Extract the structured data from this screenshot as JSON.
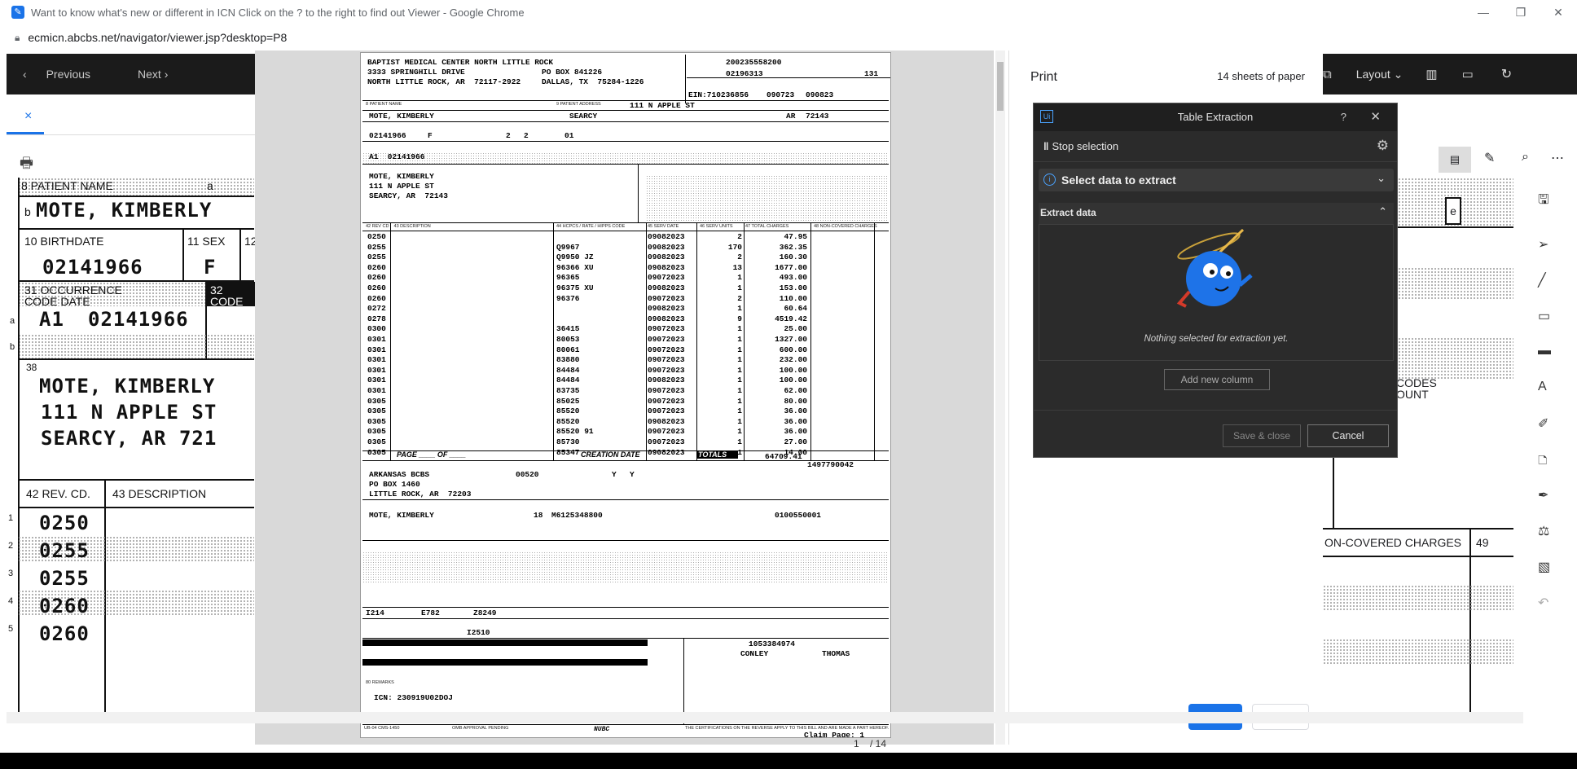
{
  "browser": {
    "title": "Want to know what's new or different in ICN Click on the ? to the right to find out Viewer - Google Chrome",
    "url": "ecmicn.abcbs.net/navigator/viewer.jsp?desktop=P8",
    "controls": {
      "minimize": "—",
      "restore": "❐",
      "close": "✕"
    }
  },
  "left_viewer": {
    "prev": "Previous",
    "next": "Next",
    "tab_close": "×",
    "doc": {
      "patient_name_label": "8 PATIENT NAME",
      "patient_name_sub": "a",
      "name": "MOTE, KIMBERLY",
      "name_sub": "b",
      "birthdate_label": "10 BIRTHDATE",
      "sex_label": "11 SEX",
      "sex_partial": "12",
      "birthdate": "02141966",
      "sex": "F",
      "occ_label_31": "31    OCCURRENCE",
      "occ_code_label": "CODE          DATE",
      "occ_label_32": "32",
      "occ_code2": "CODE",
      "row_a": "a",
      "row_b": "b",
      "occ_code": "A1",
      "occ_date": "02141966",
      "box38": "38",
      "addr1": "MOTE, KIMBERLY",
      "addr2": "111 N APPLE ST",
      "addr3": "SEARCY, AR  721",
      "rev_label": "42 REV. CD.",
      "desc_label": "43 DESCRIPTION",
      "rows": [
        {
          "n": "1",
          "code": "0250"
        },
        {
          "n": "2",
          "code": "0255"
        },
        {
          "n": "3",
          "code": "0255"
        },
        {
          "n": "4",
          "code": "0260"
        },
        {
          "n": "5",
          "code": "0260"
        }
      ]
    }
  },
  "claim": {
    "provider": [
      "BAPTIST MEDICAL CENTER NORTH LITTLE ROCK",
      "3333 SPRINGHILL DRIVE",
      "NORTH LITTLE ROCK, AR  72117-2922"
    ],
    "pay_to": [
      "PO BOX 841226",
      "DALLAS, TX  75284-1226"
    ],
    "patient_control": "200235558200",
    "med_rec": "02196313",
    "type_of_bill": "131",
    "ein": "EIN:710236856",
    "from": "090723",
    "through": "090823",
    "patient_address": "111 N APPLE ST",
    "patient_name": "MOTE, KIMBERLY",
    "city": "SEARCY",
    "state": "AR",
    "zip": "72143",
    "birthdate": "02141966",
    "sex": "F",
    "adm_type": "2",
    "adm_src": "2",
    "status": "01",
    "occ": "A1  02141966",
    "addr_block": [
      "MOTE, KIMBERLY",
      "111 N APPLE ST",
      "SEARCY, AR  72143"
    ],
    "lines": [
      {
        "rev": "0250",
        "hcpcs": "",
        "date": "09082023",
        "units": "2",
        "charge": "47.95"
      },
      {
        "rev": "0255",
        "hcpcs": "Q9967",
        "date": "09082023",
        "units": "170",
        "charge": "362.35"
      },
      {
        "rev": "0255",
        "hcpcs": "Q9950 JZ",
        "date": "09082023",
        "units": "2",
        "charge": "160.30"
      },
      {
        "rev": "0260",
        "hcpcs": "96366 XU",
        "date": "09082023",
        "units": "13",
        "charge": "1677.00"
      },
      {
        "rev": "0260",
        "hcpcs": "96365",
        "date": "09072023",
        "units": "1",
        "charge": "493.00"
      },
      {
        "rev": "0260",
        "hcpcs": "96375 XU",
        "date": "09082023",
        "units": "1",
        "charge": "153.00"
      },
      {
        "rev": "0260",
        "hcpcs": "96376",
        "date": "09072023",
        "units": "2",
        "charge": "110.00"
      },
      {
        "rev": "0272",
        "hcpcs": "",
        "date": "09082023",
        "units": "1",
        "charge": "60.64"
      },
      {
        "rev": "0278",
        "hcpcs": "",
        "date": "09082023",
        "units": "9",
        "charge": "4519.42"
      },
      {
        "rev": "0300",
        "hcpcs": "36415",
        "date": "09072023",
        "units": "1",
        "charge": "25.00"
      },
      {
        "rev": "0301",
        "hcpcs": "80053",
        "date": "09072023",
        "units": "1",
        "charge": "1327.00"
      },
      {
        "rev": "0301",
        "hcpcs": "80061",
        "date": "09072023",
        "units": "1",
        "charge": "600.00"
      },
      {
        "rev": "0301",
        "hcpcs": "83880",
        "date": "09072023",
        "units": "1",
        "charge": "232.00"
      },
      {
        "rev": "0301",
        "hcpcs": "84484",
        "date": "09072023",
        "units": "1",
        "charge": "100.00"
      },
      {
        "rev": "0301",
        "hcpcs": "84484",
        "date": "09082023",
        "units": "1",
        "charge": "100.00"
      },
      {
        "rev": "0301",
        "hcpcs": "83735",
        "date": "09072023",
        "units": "1",
        "charge": "62.00"
      },
      {
        "rev": "0305",
        "hcpcs": "85025",
        "date": "09072023",
        "units": "1",
        "charge": "80.00"
      },
      {
        "rev": "0305",
        "hcpcs": "85520",
        "date": "09072023",
        "units": "1",
        "charge": "36.00"
      },
      {
        "rev": "0305",
        "hcpcs": "85520",
        "date": "09082023",
        "units": "1",
        "charge": "36.00"
      },
      {
        "rev": "0305",
        "hcpcs": "85520 91",
        "date": "09072023",
        "units": "1",
        "charge": "36.00"
      },
      {
        "rev": "0305",
        "hcpcs": "85730",
        "date": "09072023",
        "units": "1",
        "charge": "27.00"
      },
      {
        "rev": "0305",
        "hcpcs": "85347",
        "date": "09082023",
        "units": "1",
        "charge": "14.00"
      }
    ],
    "page_of": "PAGE ____ OF ____",
    "creation_date": "CREATION DATE",
    "totals_label": "TOTALS",
    "total": "64709.41",
    "payer": [
      "ARKANSAS BCBS",
      "PO BOX 1460",
      "LITTLE ROCK, AR  72203"
    ],
    "health_plan": "00520",
    "rel_info": "Y",
    "asg_ben": "Y",
    "npi": "1497790042",
    "insured": "MOTE, KIMBERLY",
    "rel": "18",
    "insured_id": "M6125348800",
    "group": "0100550001",
    "dx": [
      "I214",
      "E782",
      "Z8249"
    ],
    "admit_dx": "I2510",
    "attending_npi": "1053384974",
    "attending_last": "CONLEY",
    "attending_first": "THOMAS",
    "remarks_icn": "ICN: 230919U02DOJ",
    "claim_page": "Claim Page: 1",
    "footer_left": "UB-04 CMS-1450",
    "footer_mid": "OMB APPROVAL PENDING",
    "footer_nubc": "NUBC",
    "footer_cert": "THE CERTIFICATIONS ON THE REVERSE APPLY TO THIS BILL AND ARE MADE A PART HEREOF."
  },
  "print_panel": {
    "title": "Print",
    "sheets": "14 sheets of paper",
    "print": "Print",
    "cancel": "Cancel"
  },
  "right_viewer": {
    "layout": "Layout",
    "codes1": "CODES",
    "codes2": "OUNT",
    "non_covered": "ON-COVERED CHARGES",
    "col49": "49",
    "e": "e"
  },
  "table_extraction": {
    "title": "Table Extraction",
    "help": "?",
    "close": "✕",
    "stop": "Stop selection",
    "select": "Select data to extract",
    "extract_header": "Extract data",
    "nothing": "Nothing selected for extraction yet.",
    "add_column": "Add new column",
    "save_close": "Save & close",
    "cancel": "Cancel"
  },
  "page_controls": {
    "page": "1",
    "of": "/ 14"
  }
}
